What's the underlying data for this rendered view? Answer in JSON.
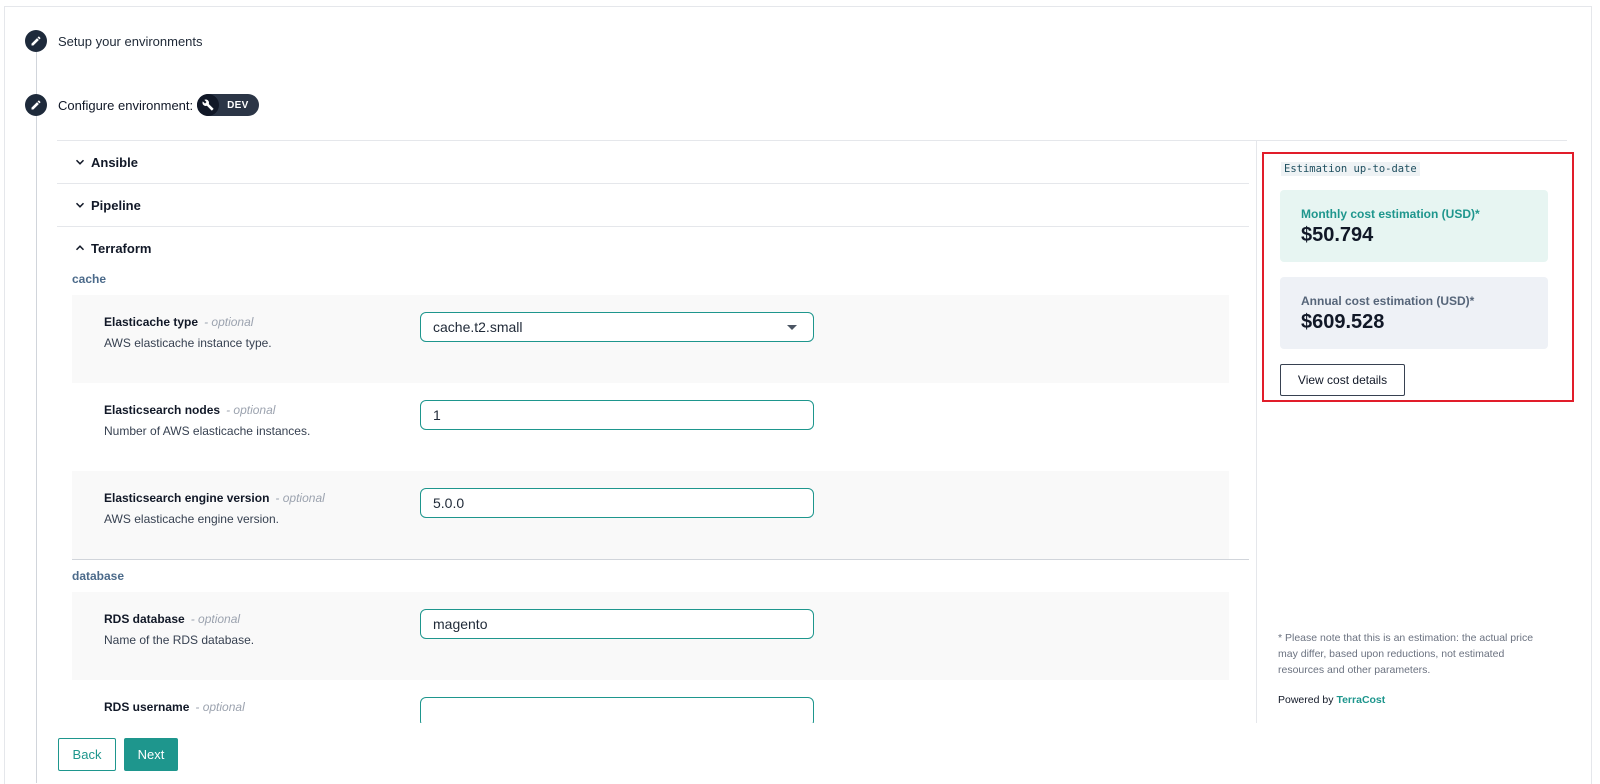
{
  "steps": [
    {
      "label": "Setup your environments",
      "icon": "pencil-icon"
    },
    {
      "label": "Configure environment:",
      "icon": "pencil-icon",
      "env_badge": {
        "icon": "wrench-icon",
        "label": "DEV"
      }
    }
  ],
  "accordions": [
    {
      "title": "Ansible",
      "state": "collapsed"
    },
    {
      "title": "Pipeline",
      "state": "collapsed"
    },
    {
      "title": "Terraform",
      "state": "expanded"
    }
  ],
  "terraform": {
    "groups": [
      {
        "name": "cache",
        "fields": [
          {
            "name": "Elasticache type",
            "optional": "- optional",
            "description": "AWS elasticache instance type.",
            "value": "cache.t2.small",
            "kind": "select"
          },
          {
            "name": "Elasticsearch nodes",
            "optional": "- optional",
            "description": "Number of AWS elasticache instances.",
            "value": "1",
            "kind": "text"
          },
          {
            "name": "Elasticsearch engine version",
            "optional": "- optional",
            "description": "AWS elasticache engine version.",
            "value": "5.0.0",
            "kind": "text"
          }
        ]
      },
      {
        "name": "database",
        "fields": [
          {
            "name": "RDS database",
            "optional": "- optional",
            "description": "Name of the RDS database.",
            "value": "magento",
            "kind": "text"
          },
          {
            "name": "RDS username",
            "optional": "- optional",
            "description": "",
            "value": "",
            "kind": "text"
          }
        ]
      }
    ]
  },
  "estimation": {
    "status": "Estimation up-to-date",
    "monthly": {
      "label": "Monthly cost estimation (USD)*",
      "value": "$50.794"
    },
    "annual": {
      "label": "Annual cost estimation (USD)*",
      "value": "$609.528"
    },
    "details_button": "View cost details",
    "disclaimer": "* Please note that this is an estimation: the actual price may differ, based upon reductions, not estimated resources and other parameters.",
    "powered_prefix": "Powered by",
    "powered_brand": "TerraCost",
    "colors": {
      "accent": "#1e968d",
      "highlight_border": "#e11d2a"
    }
  },
  "footer": {
    "back_label": "Back",
    "next_label": "Next"
  }
}
